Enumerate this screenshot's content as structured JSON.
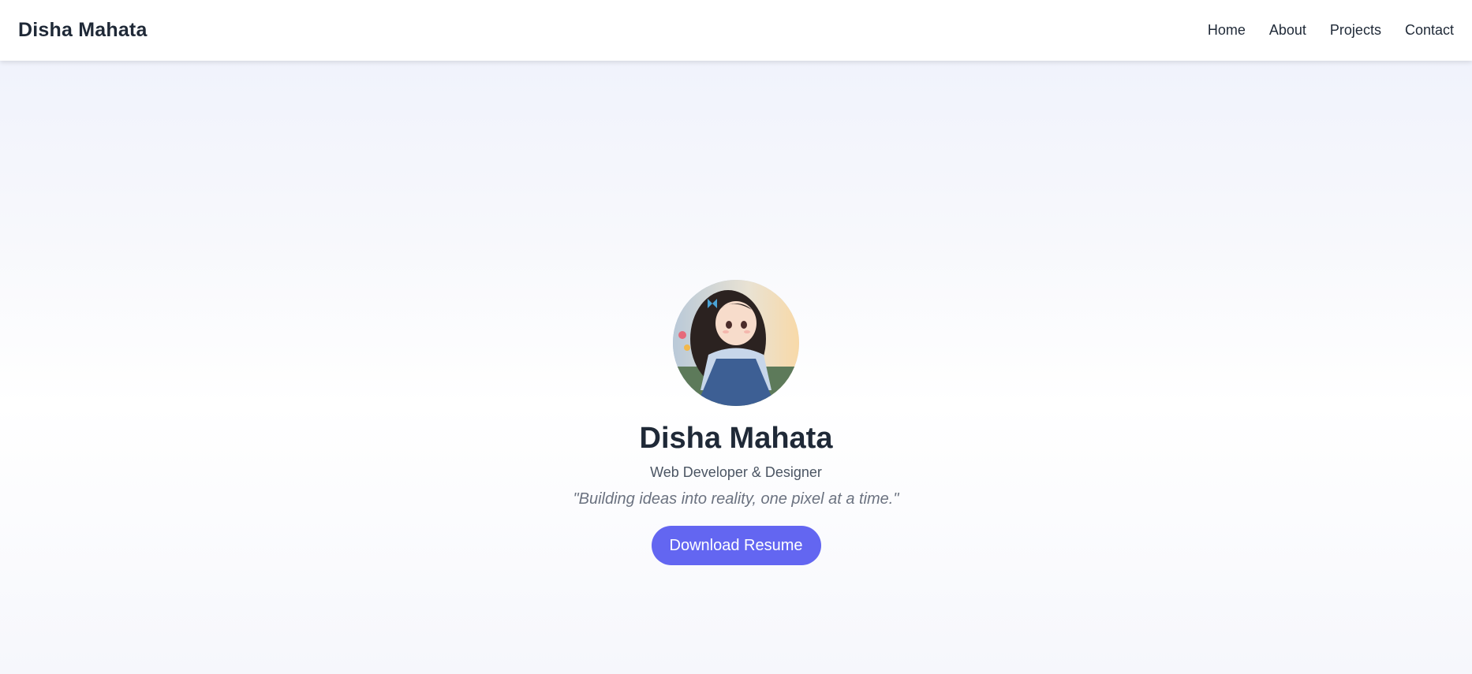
{
  "nav": {
    "brand": "Disha Mahata",
    "links": [
      {
        "label": "Home"
      },
      {
        "label": "About"
      },
      {
        "label": "Projects"
      },
      {
        "label": "Contact"
      }
    ]
  },
  "hero": {
    "avatar_alt": "profile-photo-anime-girl",
    "name": "Disha Mahata",
    "role": "Web Developer & Designer",
    "tagline": "\"Building ideas into reality, one pixel at a time.\"",
    "cta_label": "Download Resume"
  },
  "colors": {
    "accent": "#6366f1",
    "text_dark": "#1f2937",
    "text_muted": "#6b7280"
  }
}
